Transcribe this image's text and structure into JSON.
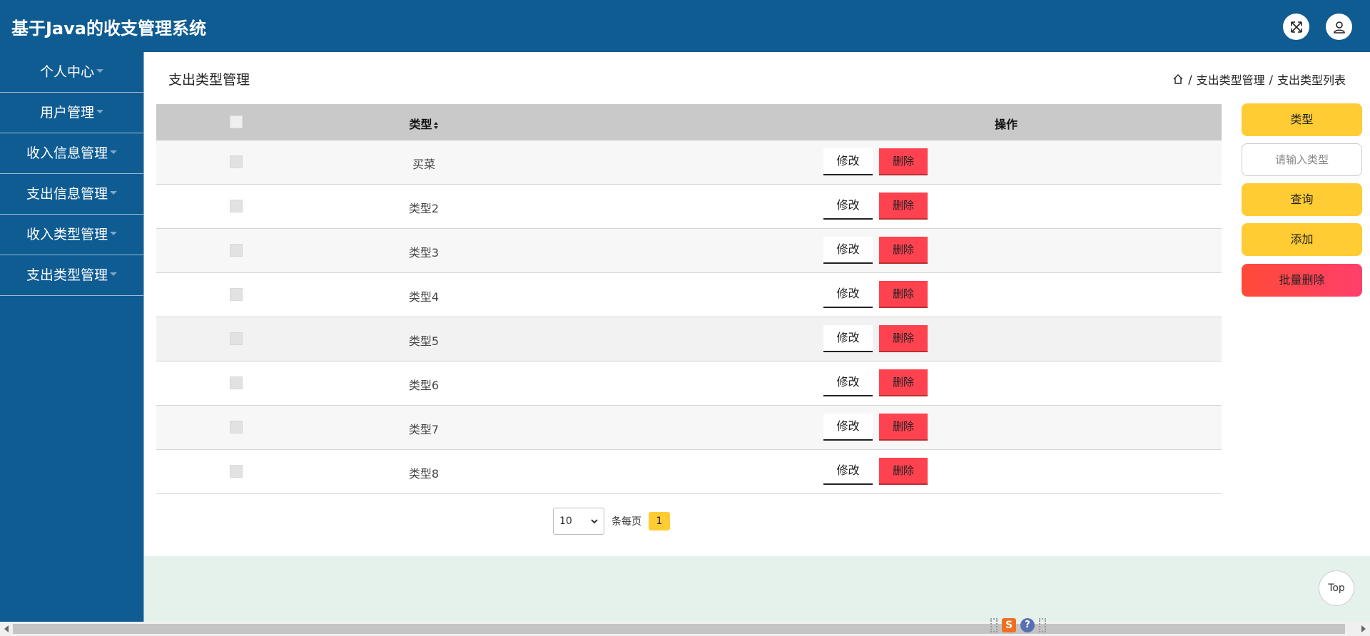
{
  "header": {
    "title": "基于Java的收支管理系统",
    "icons": [
      "fullscreen-icon",
      "user-icon"
    ]
  },
  "sidebar": {
    "items": [
      {
        "label": "个人中心"
      },
      {
        "label": "用户管理"
      },
      {
        "label": "收入信息管理"
      },
      {
        "label": "支出信息管理"
      },
      {
        "label": "收入类型管理"
      },
      {
        "label": "支出类型管理"
      }
    ]
  },
  "page": {
    "title": "支出类型管理",
    "breadcrumb": [
      "支出类型管理",
      "支出类型列表"
    ],
    "breadcrumb_sep": "/"
  },
  "table": {
    "columns": [
      "类型",
      "操作"
    ],
    "rows": [
      {
        "type": "买菜"
      },
      {
        "type": "类型2"
      },
      {
        "type": "类型3"
      },
      {
        "type": "类型4"
      },
      {
        "type": "类型5"
      },
      {
        "type": "类型6"
      },
      {
        "type": "类型7"
      },
      {
        "type": "类型8"
      }
    ],
    "edit_label": "修改",
    "delete_label": "删除"
  },
  "pagination": {
    "page_size": "10",
    "per_page_label": "条每页",
    "current_page": "1"
  },
  "search_panel": {
    "field_label": "类型",
    "placeholder": "请输入类型",
    "query_label": "查询",
    "add_label": "添加",
    "batch_delete_label": "批量删除"
  },
  "back_to_top": "Top",
  "colors": {
    "primary": "#0f5c93",
    "accent": "#ffcc33",
    "danger": "#ff4250"
  }
}
